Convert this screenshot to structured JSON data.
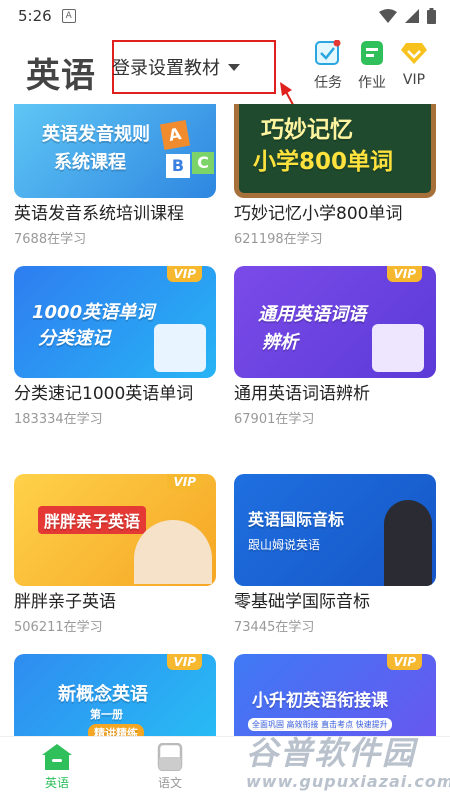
{
  "status_bar": {
    "time": "5:26",
    "notification_icon": "A-notification-icon",
    "icons": [
      "wifi-icon",
      "signal-icon",
      "battery-icon"
    ]
  },
  "header": {
    "title": "英语",
    "textbook_selector": "登录设置教材",
    "buttons": [
      {
        "label": "任务",
        "icon": "task-check-icon"
      },
      {
        "label": "作业",
        "icon": "homework-icon"
      },
      {
        "label": "VIP",
        "icon": "vip-diamond-icon"
      }
    ]
  },
  "courses": [
    {
      "title": "英语发音系统培训课程",
      "learners": "7688在学习",
      "thumb_text": [
        "英语发音规则",
        "系统课程"
      ],
      "vip": false
    },
    {
      "title": "巧妙记忆小学800单词",
      "learners": "621198在学习",
      "thumb_text": [
        "巧妙记忆",
        "小学800单词"
      ],
      "vip": false
    },
    {
      "title": "分类速记1000英语单词",
      "learners": "183334在学习",
      "thumb_text": [
        "1000英语单词",
        "分类速记"
      ],
      "vip": true
    },
    {
      "title": "通用英语词语辨析",
      "learners": "67901在学习",
      "thumb_text": [
        "通用英语词语",
        "辨析"
      ],
      "vip": true
    },
    {
      "title": "胖胖亲子英语",
      "learners": "506211在学习",
      "thumb_text": [
        "胖胖亲子英语"
      ],
      "vip": true
    },
    {
      "title": "零基础学国际音标",
      "learners": "73445在学习",
      "thumb_text": [
        "英语国际音标",
        "跟山姆说英语"
      ],
      "vip": true
    },
    {
      "title": "",
      "learners": "",
      "thumb_text": [
        "新概念英语",
        "第一册",
        "精讲精练"
      ],
      "vip": true
    },
    {
      "title": "",
      "learners": "",
      "thumb_text": [
        "小升初英语衔接课",
        "全面巩固 高效衔接 直击考点 快速提升"
      ],
      "vip": true
    }
  ],
  "vip_tag": "VIP",
  "bottom_nav": [
    {
      "label": "英语",
      "icon": "home-icon",
      "active": true
    },
    {
      "label": "语文",
      "icon": "book-icon",
      "active": false
    }
  ],
  "watermark": {
    "main": "谷普软件园",
    "sub": "www.gupuxiazai.com"
  },
  "colors": {
    "accent": "#2fbf5b",
    "vip": "#f5b82e",
    "highlight_box": "#e0201c"
  }
}
